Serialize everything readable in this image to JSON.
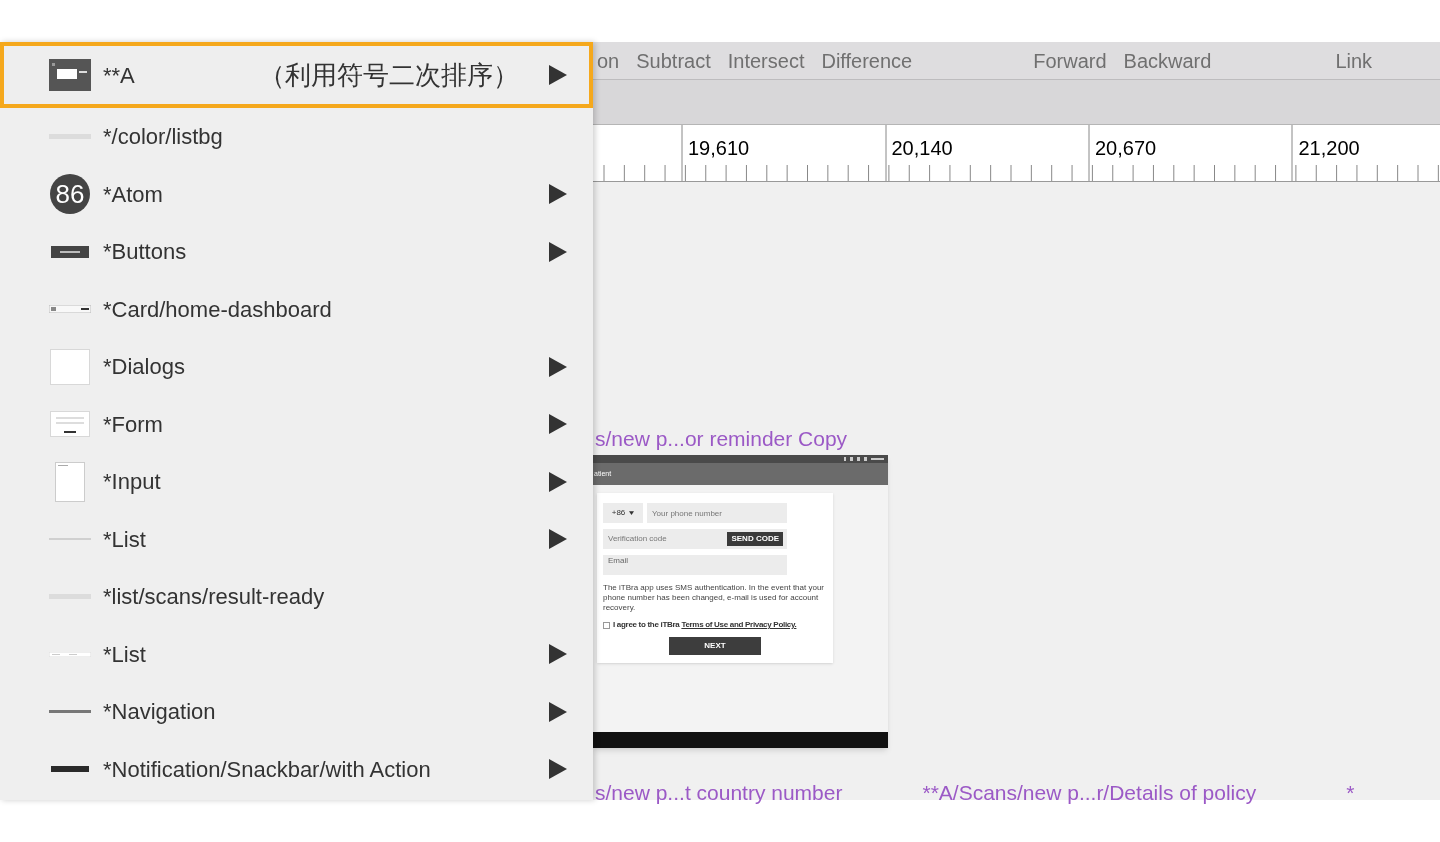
{
  "toolbar": {
    "items": [
      {
        "label": "on"
      },
      {
        "label": "Subtract"
      },
      {
        "label": "Intersect"
      },
      {
        "label": "Difference"
      },
      {
        "label": "Forward"
      },
      {
        "label": "Backward"
      },
      {
        "label": "Link"
      }
    ]
  },
  "ruler": {
    "marks": [
      "19,610",
      "20,140",
      "20,670",
      "21,200"
    ]
  },
  "canvas": {
    "artboards": [
      {
        "label": "s/new p...or reminder Copy"
      }
    ],
    "bottom_labels": [
      "s/new p...t country number",
      "**A/Scans/new p...r/Details of policy",
      "*"
    ]
  },
  "mockup": {
    "app_bar_title": "atient",
    "country_code": "+86",
    "phone_placeholder": "Your phone number",
    "code_placeholder": "Verification code",
    "send_button": "SEND CODE",
    "email_label": "Email",
    "notice": "The iTBra app uses SMS authentication. In the event that your phone number has been changed, e-mail is used for account recovery.",
    "agree_text": "I agree to the iTBra ",
    "agree_link": "Terms of Use and Privacy Policy.",
    "agree_checked": false,
    "next_button": "NEXT"
  },
  "menu": {
    "items": [
      {
        "label": "**A",
        "note": "（利用符号二次排序）",
        "kind": "panel",
        "submenu": true,
        "selected": true
      },
      {
        "label": "*/color/listbg",
        "kind": "line-light",
        "submenu": false,
        "selected": false
      },
      {
        "label": "*Atom",
        "kind": "badge",
        "badge": "86",
        "submenu": true,
        "selected": false
      },
      {
        "label": "*Buttons",
        "kind": "button",
        "submenu": true,
        "selected": false
      },
      {
        "label": "*Card/home-dashboard",
        "kind": "card",
        "submenu": false,
        "selected": false
      },
      {
        "label": "*Dialogs",
        "kind": "white-box",
        "submenu": true,
        "selected": false
      },
      {
        "label": "*Form",
        "kind": "form",
        "submenu": true,
        "selected": false
      },
      {
        "label": "*Input",
        "kind": "page",
        "submenu": true,
        "selected": false
      },
      {
        "label": "*List",
        "kind": "line-faint",
        "submenu": true,
        "selected": false
      },
      {
        "label": "*list/scans/result-ready",
        "kind": "line-light",
        "submenu": false,
        "selected": false
      },
      {
        "label": "*List",
        "kind": "strip",
        "submenu": true,
        "selected": false
      },
      {
        "label": "*Navigation",
        "kind": "line-gray",
        "submenu": true,
        "selected": false
      },
      {
        "label": "*Notification/Snackbar/with Action",
        "kind": "line-dark",
        "submenu": true,
        "selected": false
      }
    ]
  }
}
